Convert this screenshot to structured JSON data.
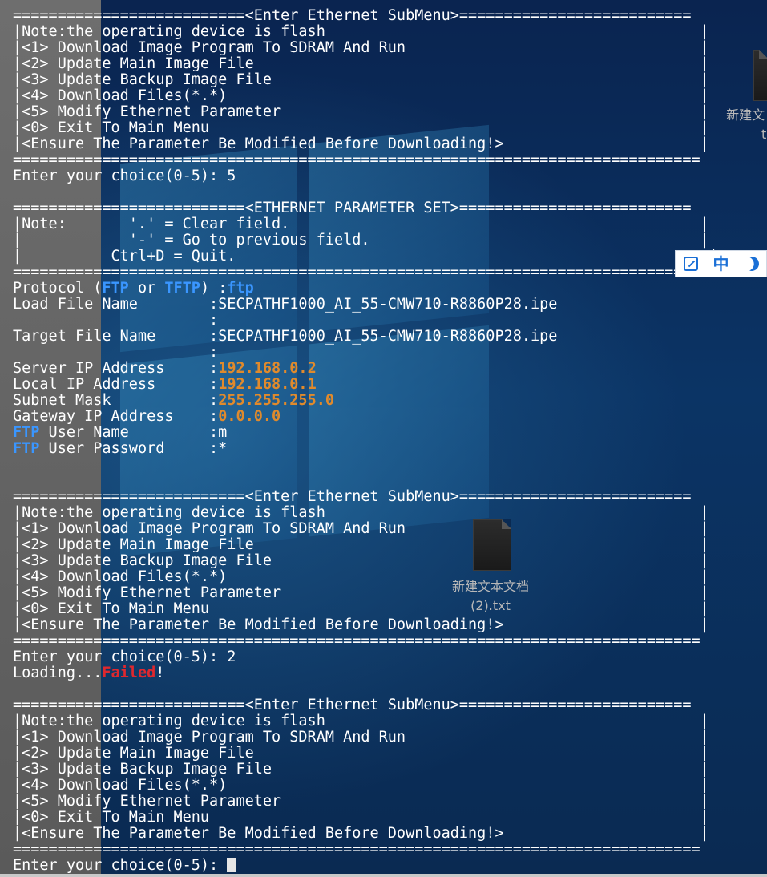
{
  "terminal": {
    "lines": [
      [
        {
          "t": "==========================<Enter Ethernet SubMenu>=========================="
        }
      ],
      [
        {
          "t": "|Note:the operating device is flash                                          |"
        }
      ],
      [
        {
          "t": "|<1> Download Image Program To SDRAM And Run                                 |"
        }
      ],
      [
        {
          "t": "|<2> Update Main Image File                                                  |"
        }
      ],
      [
        {
          "t": "|<3> Update Backup Image File                                                |"
        }
      ],
      [
        {
          "t": "|<4> Download Files(*.*)                                                     |"
        }
      ],
      [
        {
          "t": "|<5> Modify Ethernet Parameter                                               |"
        }
      ],
      [
        {
          "t": "|<0> Exit To Main Menu                                                       |"
        }
      ],
      [
        {
          "t": "|<Ensure The Parameter Be Modified Before Downloading!>                      |"
        }
      ],
      [
        {
          "t": "============================================================================="
        }
      ],
      [
        {
          "t": "Enter your choice(0-5): 5"
        }
      ],
      [
        {
          "t": ""
        }
      ],
      [
        {
          "t": "==========================<ETHERNET PARAMETER SET>=========================="
        }
      ],
      [
        {
          "t": "|Note:       '.' = Clear field.                                              |"
        }
      ],
      [
        {
          "t": "|            '-' = Go to previous field.                                     |"
        }
      ],
      [
        {
          "t": "|          Ctrl+D = Quit.                                                     |"
        }
      ],
      [
        {
          "t": "============================================================================="
        }
      ],
      [
        {
          "t": "Protocol ("
        },
        {
          "t": "FTP",
          "c": "blue"
        },
        {
          "t": " or "
        },
        {
          "t": "TFTP",
          "c": "blue"
        },
        {
          "t": ") :"
        },
        {
          "t": "ftp",
          "c": "blue"
        }
      ],
      [
        {
          "t": "Load File Name        :SECPATHF1000_AI_55-CMW710-R8860P28.ipe"
        }
      ],
      [
        {
          "t": "                      :"
        }
      ],
      [
        {
          "t": "Target File Name      :SECPATHF1000_AI_55-CMW710-R8860P28.ipe"
        }
      ],
      [
        {
          "t": "                      :"
        }
      ],
      [
        {
          "t": "Server IP Address     :"
        },
        {
          "t": "192.168.0.2",
          "c": "orange"
        }
      ],
      [
        {
          "t": "Local IP Address      :"
        },
        {
          "t": "192.168.0.1",
          "c": "orange"
        }
      ],
      [
        {
          "t": "Subnet Mask           :"
        },
        {
          "t": "255.255.255.0",
          "c": "orange"
        }
      ],
      [
        {
          "t": "Gateway IP Address    :"
        },
        {
          "t": "0.0.0.0",
          "c": "orange"
        }
      ],
      [
        {
          "t": "FTP",
          "c": "blue"
        },
        {
          "t": " User Name         :m"
        }
      ],
      [
        {
          "t": "FTP",
          "c": "blue"
        },
        {
          "t": " User Password     :*"
        }
      ],
      [
        {
          "t": ""
        }
      ],
      [
        {
          "t": ""
        }
      ],
      [
        {
          "t": "==========================<Enter Ethernet SubMenu>=========================="
        }
      ],
      [
        {
          "t": "|Note:the operating device is flash                                          |"
        }
      ],
      [
        {
          "t": "|<1> Download Image Program To SDRAM And Run                                 |"
        }
      ],
      [
        {
          "t": "|<2> Update Main Image File                                                  |"
        }
      ],
      [
        {
          "t": "|<3> Update Backup Image File                                                |"
        }
      ],
      [
        {
          "t": "|<4> Download Files(*.*)                                                     |"
        }
      ],
      [
        {
          "t": "|<5> Modify Ethernet Parameter                                               |"
        }
      ],
      [
        {
          "t": "|<0> Exit To Main Menu                                                       |"
        }
      ],
      [
        {
          "t": "|<Ensure The Parameter Be Modified Before Downloading!>                      |"
        }
      ],
      [
        {
          "t": "============================================================================="
        }
      ],
      [
        {
          "t": "Enter your choice(0-5): 2"
        }
      ],
      [
        {
          "t": "Loading..."
        },
        {
          "t": "Failed",
          "c": "red"
        },
        {
          "t": "!"
        }
      ],
      [
        {
          "t": ""
        }
      ],
      [
        {
          "t": "==========================<Enter Ethernet SubMenu>=========================="
        }
      ],
      [
        {
          "t": "|Note:the operating device is flash                                          |"
        }
      ],
      [
        {
          "t": "|<1> Download Image Program To SDRAM And Run                                 |"
        }
      ],
      [
        {
          "t": "|<2> Update Main Image File                                                  |"
        }
      ],
      [
        {
          "t": "|<3> Update Backup Image File                                                |"
        }
      ],
      [
        {
          "t": "|<4> Download Files(*.*)                                                     |"
        }
      ],
      [
        {
          "t": "|<5> Modify Ethernet Parameter                                               |"
        }
      ],
      [
        {
          "t": "|<0> Exit To Main Menu                                                       |"
        }
      ],
      [
        {
          "t": "|<Ensure The Parameter Be Modified Before Downloading!>                      |"
        }
      ],
      [
        {
          "t": "============================================================================="
        }
      ]
    ],
    "prompt": "Enter your choice(0-5): "
  },
  "desktop": {
    "file1_label_line1": "新建文",
    "file1_label_line2": "t",
    "file2_label_line1": "新建文本文档",
    "file2_label_line2": "(2).txt"
  },
  "ime": {
    "mode_label": "中"
  },
  "colors": {
    "terminal_bg": "#0a2a52",
    "text": "#ffffff",
    "highlight_blue": "#3a96ff",
    "highlight_orange": "#e08a2c",
    "error_red": "#e0282e"
  }
}
